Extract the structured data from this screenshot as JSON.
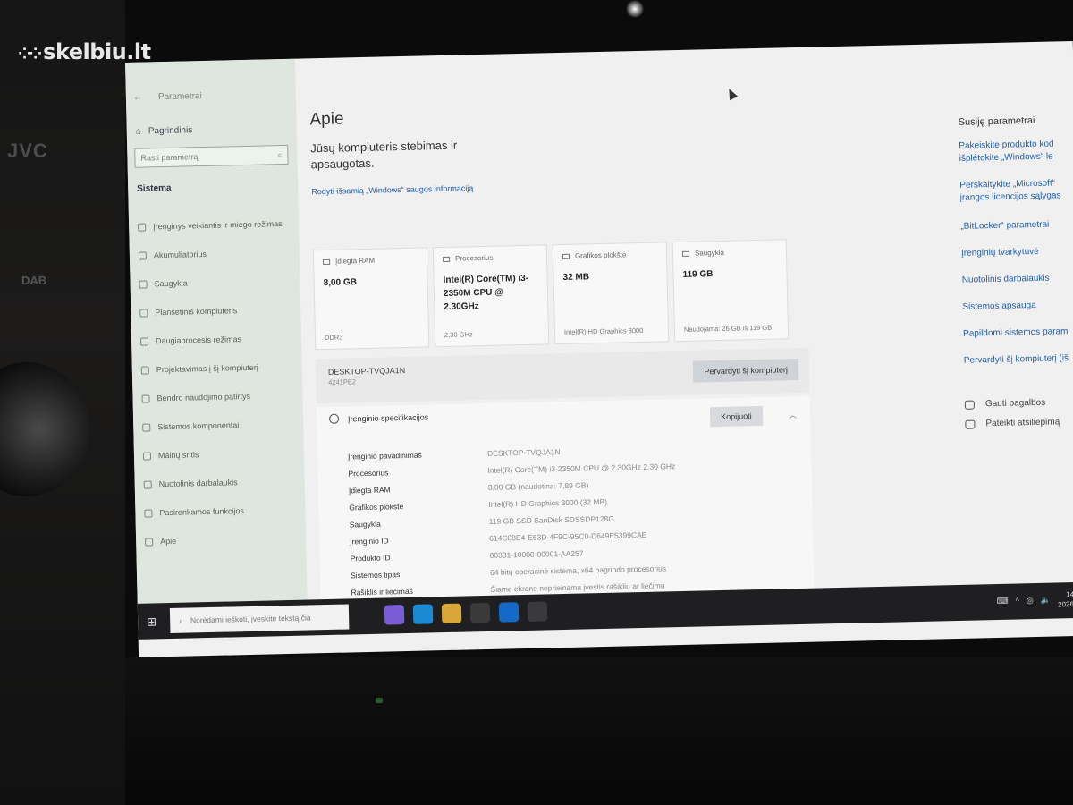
{
  "watermark": "skelbiu.lt",
  "photo_labels": {
    "brand": "JVC",
    "dab": "DAB"
  },
  "sidebar": {
    "back_title": "Parametrai",
    "home": "Pagrindinis",
    "search_placeholder": "Rasti parametrą",
    "section": "Sistema",
    "items": [
      {
        "icon": "power-icon",
        "label": "Įrenginys veikiantis ir miego režimas"
      },
      {
        "icon": "battery-icon",
        "label": "Akumuliatorius"
      },
      {
        "icon": "storage-icon",
        "label": "Saugykla"
      },
      {
        "icon": "tablet-icon",
        "label": "Planšetinis kompiuteris"
      },
      {
        "icon": "multitask-icon",
        "label": "Daugiaprocesis režimas"
      },
      {
        "icon": "project-icon",
        "label": "Projektavimas į šį kompiuterį"
      },
      {
        "icon": "shared-icon",
        "label": "Bendro naudojimo patirtys"
      },
      {
        "icon": "components-icon",
        "label": "Sistemos komponentai"
      },
      {
        "icon": "clipboard-icon",
        "label": "Mainų sritis"
      },
      {
        "icon": "remote-icon",
        "label": "Nuotolinis darbalaukis"
      },
      {
        "icon": "optional-icon",
        "label": "Pasirenkamos funkcijos"
      },
      {
        "icon": "info-icon",
        "label": "Apie"
      }
    ]
  },
  "main": {
    "title": "Apie",
    "protection": "Jūsų kompiuteris stebimas ir apsaugotas.",
    "security_link": "Rodyti išsamią „Windows“ saugos informaciją",
    "cards": [
      {
        "icon": "ram-icon",
        "label": "Įdiegta RAM",
        "value": "8,00 GB",
        "foot": "DDR3"
      },
      {
        "icon": "cpu-icon",
        "label": "Procesorius",
        "value": "Intel(R) Core(TM) i3-2350M CPU @ 2.30GHz",
        "foot": "2,30 GHz"
      },
      {
        "icon": "gpu-icon",
        "label": "Grafikos plokštė",
        "value": "32 MB",
        "foot": "Intel(R) HD Graphics 3000"
      },
      {
        "icon": "drive-icon",
        "label": "Saugykla",
        "value": "119 GB",
        "foot": "Naudojama: 26 GB iš 119 GB"
      }
    ],
    "device_name": "DESKTOP-TVQJA1N",
    "device_sub": "4241PE2",
    "rename_button": "Pervardyti šį kompiuterį",
    "specs_title": "Įrenginio specifikacijos",
    "copy_button": "Kopijuoti",
    "specs": [
      {
        "k": "Įrenginio pavadinimas",
        "v": "DESKTOP-TVQJA1N"
      },
      {
        "k": "Procesorius",
        "v": "Intel(R) Core(TM) i3-2350M CPU @ 2.30GHz   2.30 GHz"
      },
      {
        "k": "Įdiegta RAM",
        "v": "8,00 GB (naudotina: 7,89 GB)"
      },
      {
        "k": "Grafikos plokštė",
        "v": "Intel(R) HD Graphics 3000 (32 MB)"
      },
      {
        "k": "Saugykla",
        "v": "119 GB SSD SanDisk SDSSDP128G"
      },
      {
        "k": "Įrenginio ID",
        "v": "614C08E4-E63D-4F9C-95C0-D649E5399CAE"
      },
      {
        "k": "Produkto ID",
        "v": "00331-10000-00001-AA257"
      },
      {
        "k": "Sistemos tipas",
        "v": "64 bitų operacinė sistema, x64 pagrindo procesorius"
      },
      {
        "k": "Rašiklis ir liečimas",
        "v": "Šiame ekrane neprieinama įvestis rašikliu ar liečimu"
      }
    ]
  },
  "related": {
    "title": "Susiję parametrai",
    "links": [
      "Pakeiskite produkto kod",
      "išplėtokite „Windows“ le",
      "Perskaitykite „Microsoft“",
      "įrangos licencijos sąlygas",
      "„BitLocker“ parametrai",
      "Įrenginių tvarkytuvė",
      "Nuotolinis darbalaukis",
      "Sistemos apsauga",
      "Papildomi sistemos param",
      "Pervardyti šį kompiuterį (iš"
    ],
    "help": "Gauti pagalbos",
    "feedback": "Pateikti atsiliepimą"
  },
  "taskbar": {
    "search_placeholder": "Norėdami ieškoti, įveskite tekstą čia",
    "apps": [
      {
        "icon": "task-view-icon",
        "color": "#1f1f22"
      },
      {
        "icon": "copilot-icon",
        "color": "#7a5cd6"
      },
      {
        "icon": "edge-icon",
        "color": "#1a8ad4"
      },
      {
        "icon": "explorer-icon",
        "color": "#d9a638"
      },
      {
        "icon": "calendar-icon",
        "color": "#3a3a3a"
      },
      {
        "icon": "outlook-icon",
        "color": "#1468c6"
      },
      {
        "icon": "settings-icon",
        "color": "#3a3a3e"
      }
    ],
    "time": "14:5",
    "date": "2026-0"
  }
}
